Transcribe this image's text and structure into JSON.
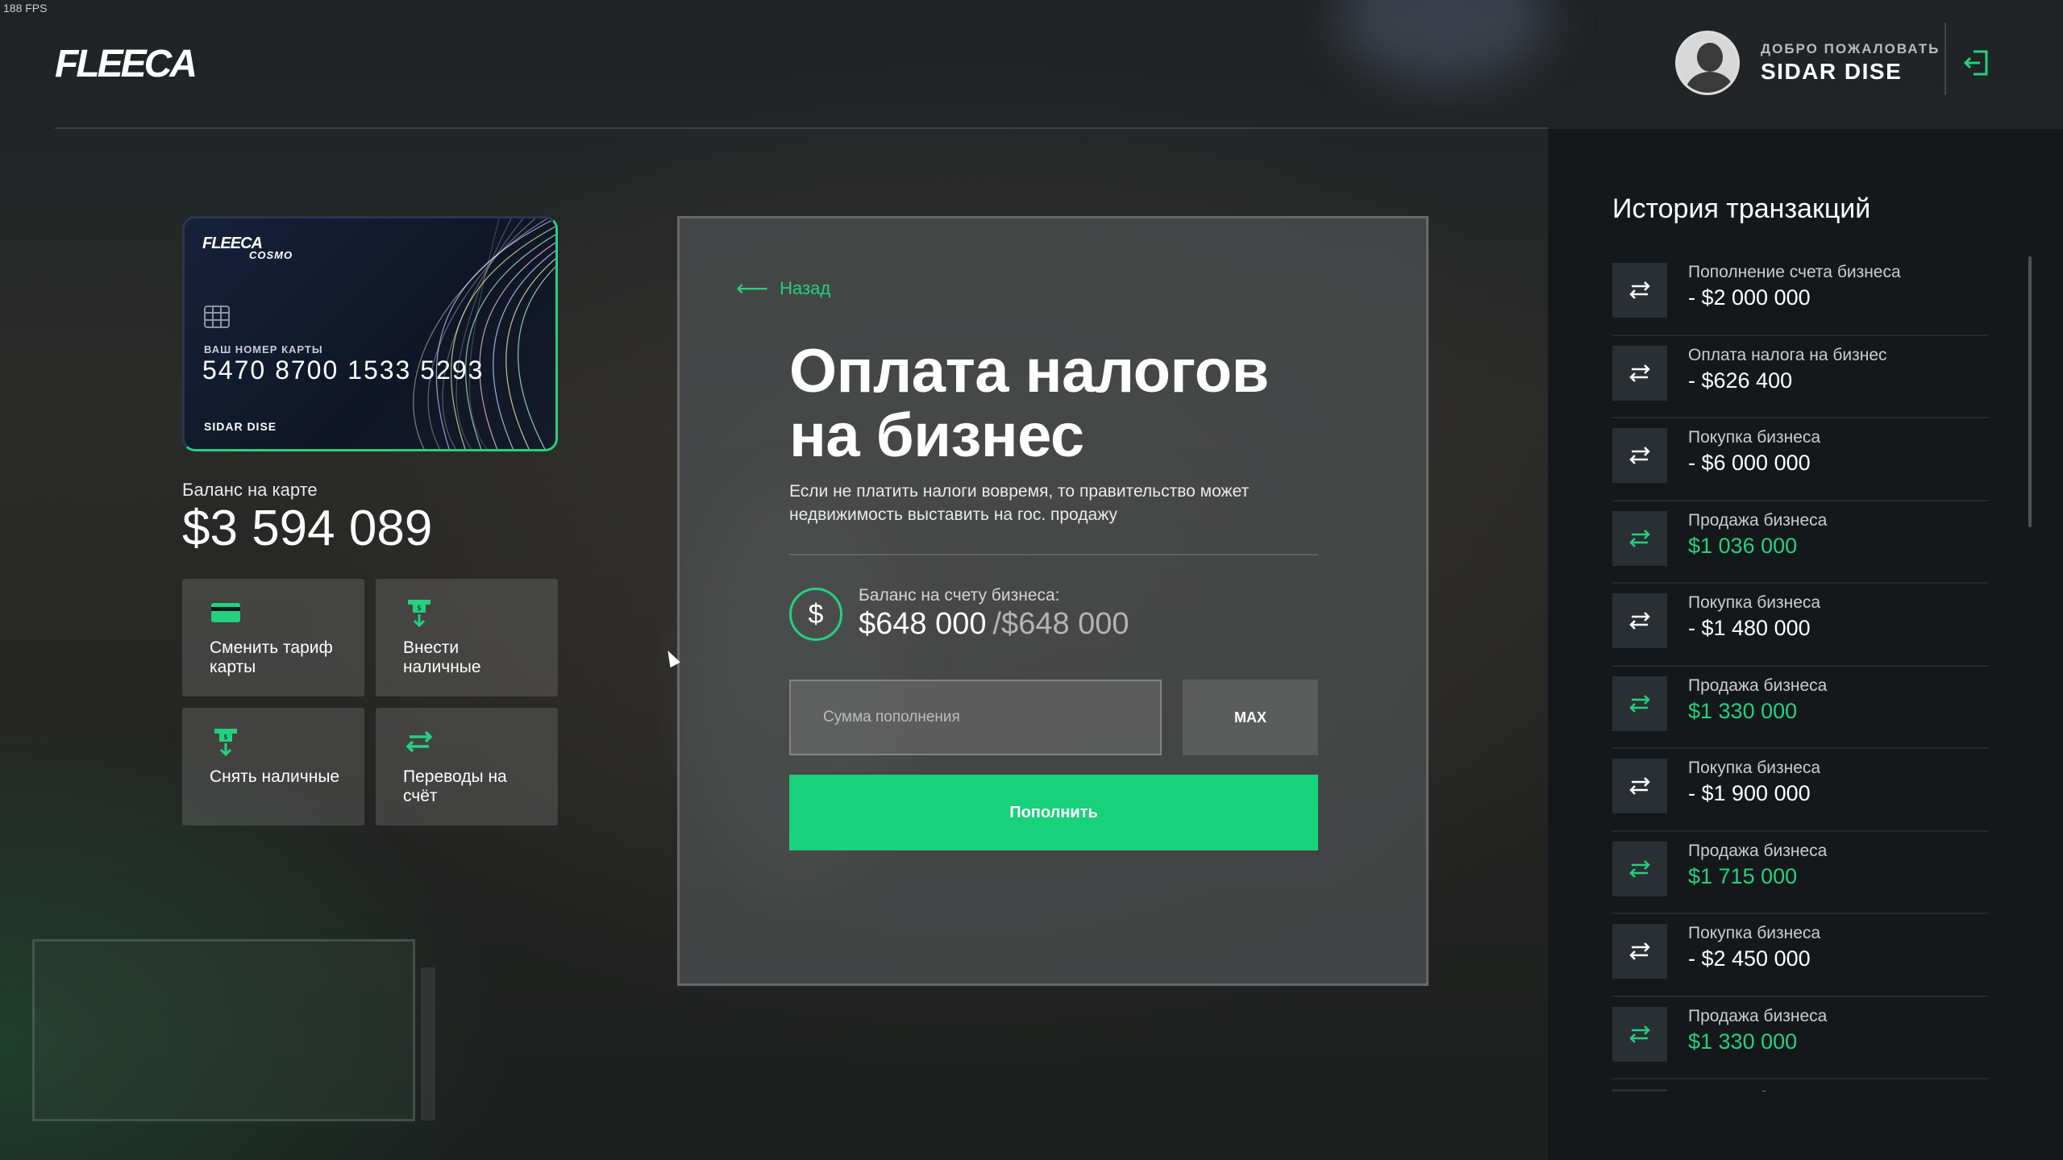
{
  "fps": "188 FPS",
  "brand": "FLEECA",
  "header": {
    "welcome": "ДОБРО ПОЖАЛОВАТЬ",
    "username": "SIDAR DISE"
  },
  "card": {
    "brand": "FLEECA",
    "tier": "COSMO",
    "number_label": "ВАШ НОМЕР КАРТЫ",
    "number": "5470 8700 1533 5293",
    "holder": "SIDAR DISE"
  },
  "balance": {
    "label": "Баланс на карте",
    "value": "$3 594 089"
  },
  "actions": [
    {
      "label": "Сменить тариф карты",
      "icon": "card-icon"
    },
    {
      "label": "Внести наличные",
      "icon": "deposit-icon"
    },
    {
      "label": "Снять наличные",
      "icon": "withdraw-icon"
    },
    {
      "label": "Переводы на счёт",
      "icon": "transfer-icon"
    }
  ],
  "modal": {
    "back": "Назад",
    "title": "Оплата налогов на бизнес",
    "description": "Если не платить налоги вовремя, то правительство может недвижимость выставить на гос. продажу",
    "balance_label": "Баланс на счету бизнеса:",
    "balance_current": "$648 000",
    "balance_max": "/$648 000",
    "input_placeholder": "Сумма пополнения",
    "max_label": "MAX",
    "submit_label": "Пополнить"
  },
  "history": {
    "title": "История транзакций",
    "items": [
      {
        "title": "Пополнение счета бизнеса",
        "amount": "- $2 000 000",
        "color": "#ffffff"
      },
      {
        "title": "Оплата налога на бизнес",
        "amount": "- $626 400",
        "color": "#ffffff"
      },
      {
        "title": "Покупка бизнеса",
        "amount": "- $6 000 000",
        "color": "#ffffff"
      },
      {
        "title": "Продажа бизнеса",
        "amount": "$1 036 000",
        "color": "#25d07f"
      },
      {
        "title": "Покупка бизнеса",
        "amount": "- $1 480 000",
        "color": "#ffffff"
      },
      {
        "title": "Продажа бизнеса",
        "amount": "$1 330 000",
        "color": "#25d07f"
      },
      {
        "title": "Покупка бизнеса",
        "amount": "- $1 900 000",
        "color": "#ffffff"
      },
      {
        "title": "Продажа бизнеса",
        "amount": "$1 715 000",
        "color": "#25d07f"
      },
      {
        "title": "Покупка бизнеса",
        "amount": "- $2 450 000",
        "color": "#ffffff"
      },
      {
        "title": "Продажа бизнеса",
        "amount": "$1 330 000",
        "color": "#25d07f"
      },
      {
        "title": "Покупка бизнеса",
        "amount": "",
        "color": "#ffffff"
      }
    ]
  },
  "colors": {
    "accent": "#25d07f",
    "panel": "#15181b"
  }
}
